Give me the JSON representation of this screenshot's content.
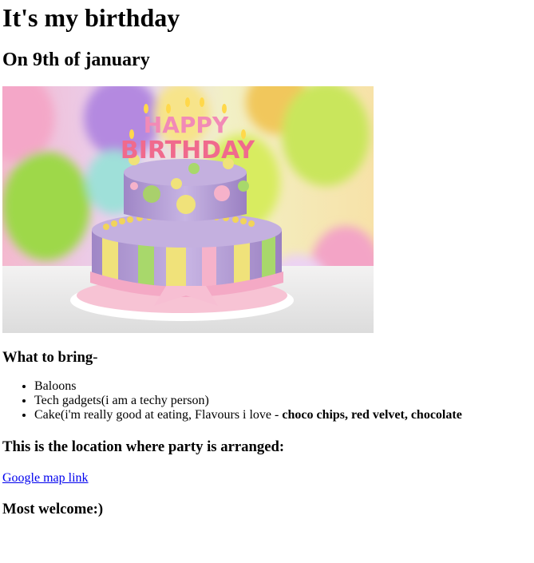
{
  "page": {
    "title": "It's my birthday",
    "date": "On 9th of january",
    "image_alt": "HAPPY BIRTHDAY cake with balloons",
    "cake_candle_text_line1": "HAPPY",
    "cake_candle_text_line2": "BIRTHDAY"
  },
  "bring": {
    "heading": "What to bring",
    "heading_suffix": "-",
    "items": [
      {
        "text": "Baloons"
      },
      {
        "text": "Tech gadgets(i am a techy person)"
      },
      {
        "text": "Cake(i'm really good at eating, Flavours i love - ",
        "bold": "choco chips, red velvet, chocolate"
      }
    ]
  },
  "location": {
    "heading": "This is the location where party is arranged:",
    "link_text": "Google map link"
  },
  "closing": {
    "text": "Most welcome:)"
  },
  "colors": {
    "link": "#0000ee",
    "text": "#000000",
    "background": "#ffffff"
  }
}
